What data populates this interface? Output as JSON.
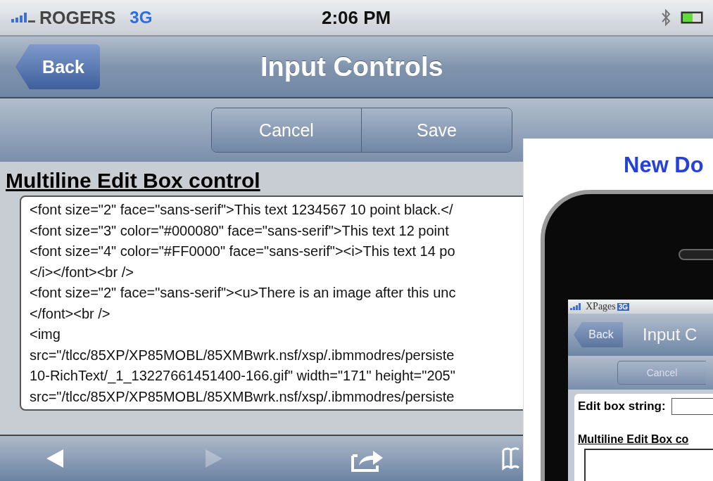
{
  "status_bar": {
    "carrier": "ROGERS",
    "network": "3G",
    "time": "2:06 PM"
  },
  "nav_bar": {
    "back_button": "Back",
    "title": "Input Controls"
  },
  "toolbar": {
    "buttons": [
      "Cancel",
      "Save"
    ]
  },
  "section": {
    "heading": "Multiline Edit Box control",
    "text_lines": [
      "<font size=\"2\" face=\"sans-serif\">This text 1234567 10 point black.</",
      "<font size=\"3\" color=\"#000080\" face=\"sans-serif\">This text 12 point",
      "<font size=\"4\" color=\"#FF0000\" face=\"sans-serif\"><i>This text 14 po",
      "</i></font><br />",
      "<font size=\"2\" face=\"sans-serif\"><u>There is an image after this unc",
      "</font><br />",
      "<img",
      "src=\"/tlcc/85XP/XP85MOBL/85XMBwrk.nsf/xsp/.ibmmodres/persiste",
      "10-RichText/_1_13227661451400-166.gif\" width=\"171\" height=\"205\"",
      "src=\"/tlcc/85XP/XP85MOBL/85XMBwrk.nsf/xsp/.ibmmodres/persiste"
    ]
  },
  "bottom_toolbar": [
    {
      "kind": "back",
      "disabled": false
    },
    {
      "kind": "forward",
      "disabled": true
    },
    {
      "kind": "share",
      "disabled": false
    },
    {
      "kind": "bookmarks",
      "disabled": false
    }
  ],
  "overlay": {
    "heading": "New Do",
    "phone_screen": {
      "carrier": "XPages",
      "network": "3G",
      "back_button": "Back",
      "title": "Input C",
      "toolbar_button": "Cancel",
      "field_label": "Edit box string:",
      "section_heading": "Multiline Edit Box co"
    }
  }
}
